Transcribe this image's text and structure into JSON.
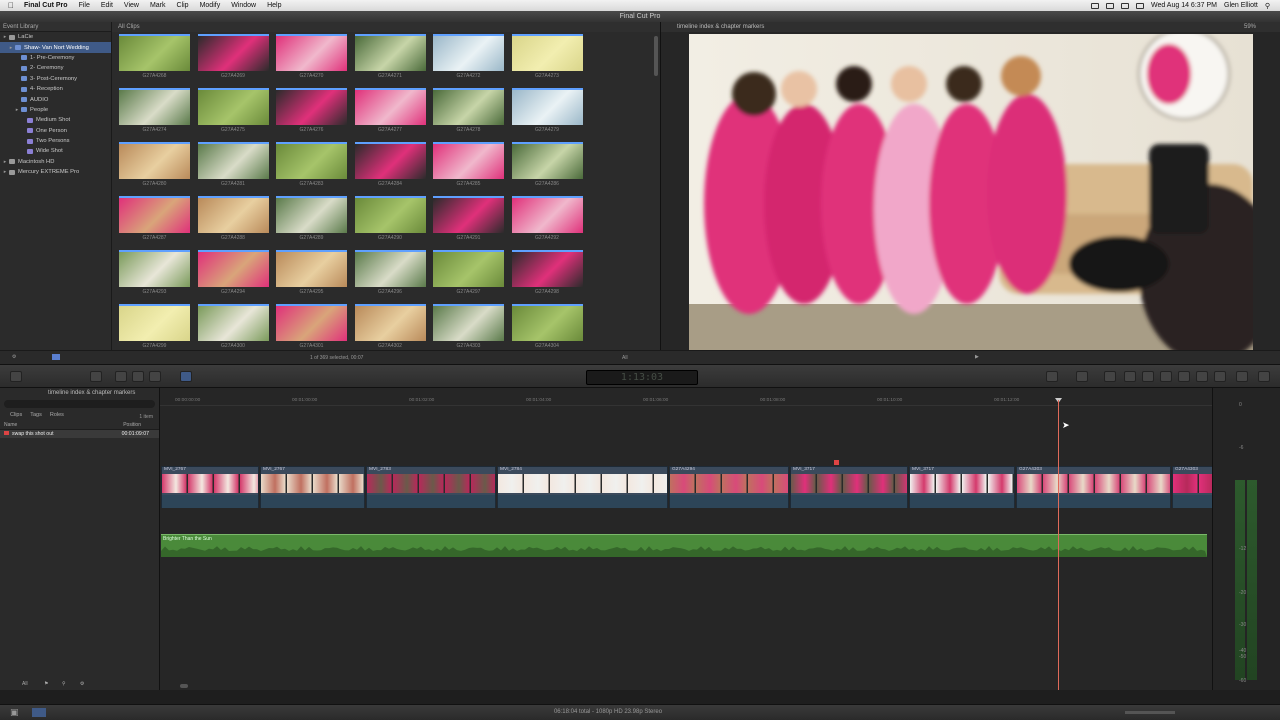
{
  "menubar": {
    "app_name": "Final Cut Pro",
    "menus": [
      "File",
      "Edit",
      "View",
      "Mark",
      "Clip",
      "Modify",
      "Window",
      "Help"
    ],
    "datetime": "Wed Aug 14  6:37 PM",
    "user": "Glen Elliott"
  },
  "window": {
    "title": "Final Cut Pro"
  },
  "library": {
    "header": "Event Library",
    "items": [
      {
        "label": "LaCie",
        "level": 0,
        "kind": "drive"
      },
      {
        "label": "Shaw- Van Nort Wedding",
        "level": 1,
        "kind": "event",
        "selected": true
      },
      {
        "label": "1- Pre-Ceremony",
        "level": 2,
        "kind": "folder"
      },
      {
        "label": "2- Ceremony",
        "level": 2,
        "kind": "folder"
      },
      {
        "label": "3- Post-Ceremony",
        "level": 2,
        "kind": "folder"
      },
      {
        "label": "4- Reception",
        "level": 2,
        "kind": "folder"
      },
      {
        "label": "AUDIO",
        "level": 2,
        "kind": "folder"
      },
      {
        "label": "People",
        "level": 2,
        "kind": "folder"
      },
      {
        "label": "Medium Shot",
        "level": 3,
        "kind": "keyword"
      },
      {
        "label": "One Person",
        "level": 3,
        "kind": "keyword"
      },
      {
        "label": "Two Persons",
        "level": 3,
        "kind": "keyword"
      },
      {
        "label": "Wide Shot",
        "level": 3,
        "kind": "keyword"
      },
      {
        "label": "Macintosh HD",
        "level": 0,
        "kind": "drive"
      },
      {
        "label": "Mercury EXTREME Pro",
        "level": 0,
        "kind": "drive"
      }
    ]
  },
  "browser": {
    "header": "All Clips",
    "clips": [
      "G27A4268",
      "G27A4269",
      "G27A4270",
      "G27A4271",
      "G27A4272",
      "G27A4273",
      "G27A4274",
      "G27A4275",
      "G27A4276",
      "G27A4277",
      "G27A4278",
      "G27A4279",
      "G27A4280",
      "G27A4281",
      "G27A4283",
      "G27A4284",
      "G27A4285",
      "G27A4286",
      "G27A4287",
      "G27A4288",
      "G27A4289",
      "G27A4290",
      "G27A4291",
      "G27A4292",
      "G27A4293",
      "G27A4294",
      "G27A4295",
      "G27A4296",
      "G27A4297",
      "G27A4298",
      "G27A4299",
      "G27A4300",
      "G27A4301",
      "G27A4302",
      "G27A4303",
      "G27A4304"
    ],
    "selection_info": "1 of 369 selected, 00:07",
    "filter": "All"
  },
  "viewer": {
    "title": "timeline index & chapter markers",
    "zoom": "59%"
  },
  "toolbar": {
    "timecode": "1:13:03"
  },
  "timeline_index": {
    "title": "timeline index & chapter markers",
    "tabs": [
      "Clips",
      "Tags",
      "Roles"
    ],
    "count": "1 item",
    "col_name": "Name",
    "col_position": "Position",
    "rows": [
      {
        "name": "swap this shot out",
        "position": "00:01:09:07"
      }
    ]
  },
  "timeline": {
    "ruler": [
      "00:00:00:00",
      "00:01:00:00",
      "00:01:02:00",
      "00:01:04:00",
      "00:01:06:00",
      "00:01:08:00",
      "00:01:10:00",
      "00:01:12:00"
    ],
    "clips": [
      {
        "name": "MVI_2767"
      },
      {
        "name": "MVI_2767"
      },
      {
        "name": "MVI_2783"
      },
      {
        "name": "MVI_2784"
      },
      {
        "name": "G27A4294"
      },
      {
        "name": "MVI_3717"
      },
      {
        "name": "MVI_3717"
      },
      {
        "name": "G27A4303"
      },
      {
        "name": "G27A4303"
      }
    ],
    "music_name": "Brighter Than the Sun"
  },
  "meters": {
    "labels": [
      "0",
      "-6",
      "-12",
      "-20",
      "-30",
      "-40",
      "-50",
      "-60"
    ]
  },
  "status": {
    "text": "06:18:04 total - 1080p HD 23.98p Stereo"
  },
  "colors": {
    "selection": "#3f5a87",
    "clip_blue": "#3b4a5c",
    "music_green": "#4a8a3a",
    "playhead": "#e06a5a",
    "robe_pink": "#e0307a"
  }
}
